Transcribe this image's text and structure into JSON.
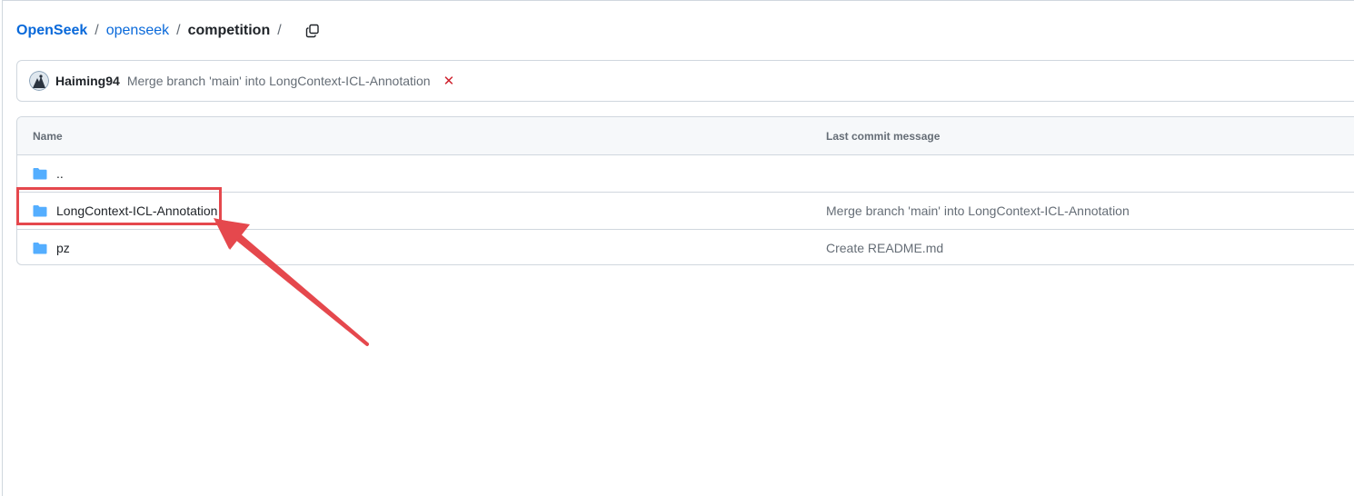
{
  "breadcrumb": {
    "owner": "OpenSeek",
    "repo": "openseek",
    "current": "competition",
    "separator": "/",
    "copy_icon": "copy-icon"
  },
  "latest_commit": {
    "author": "Haiming94",
    "message": "Merge branch 'main' into LongContext-ICL-Annotation",
    "status_symbol": "✕",
    "status_color": "#cf222e"
  },
  "table": {
    "headers": {
      "name": "Name",
      "last_commit_message": "Last commit message"
    },
    "rows": [
      {
        "name": "..",
        "message": "",
        "icon": "folder-icon"
      },
      {
        "name": "LongContext-ICL-Annotation",
        "message": "Merge branch 'main' into LongContext-ICL-Annotation",
        "icon": "folder-icon"
      },
      {
        "name": "pz",
        "message": "Create README.md",
        "icon": "folder-icon"
      }
    ]
  },
  "annotation": {
    "color": "#e5484d",
    "target": "LongContext-ICL-Annotation"
  },
  "colors": {
    "link": "#0969da",
    "folder": "#54aeff",
    "muted": "#656d76",
    "border": "#d0d7de"
  }
}
